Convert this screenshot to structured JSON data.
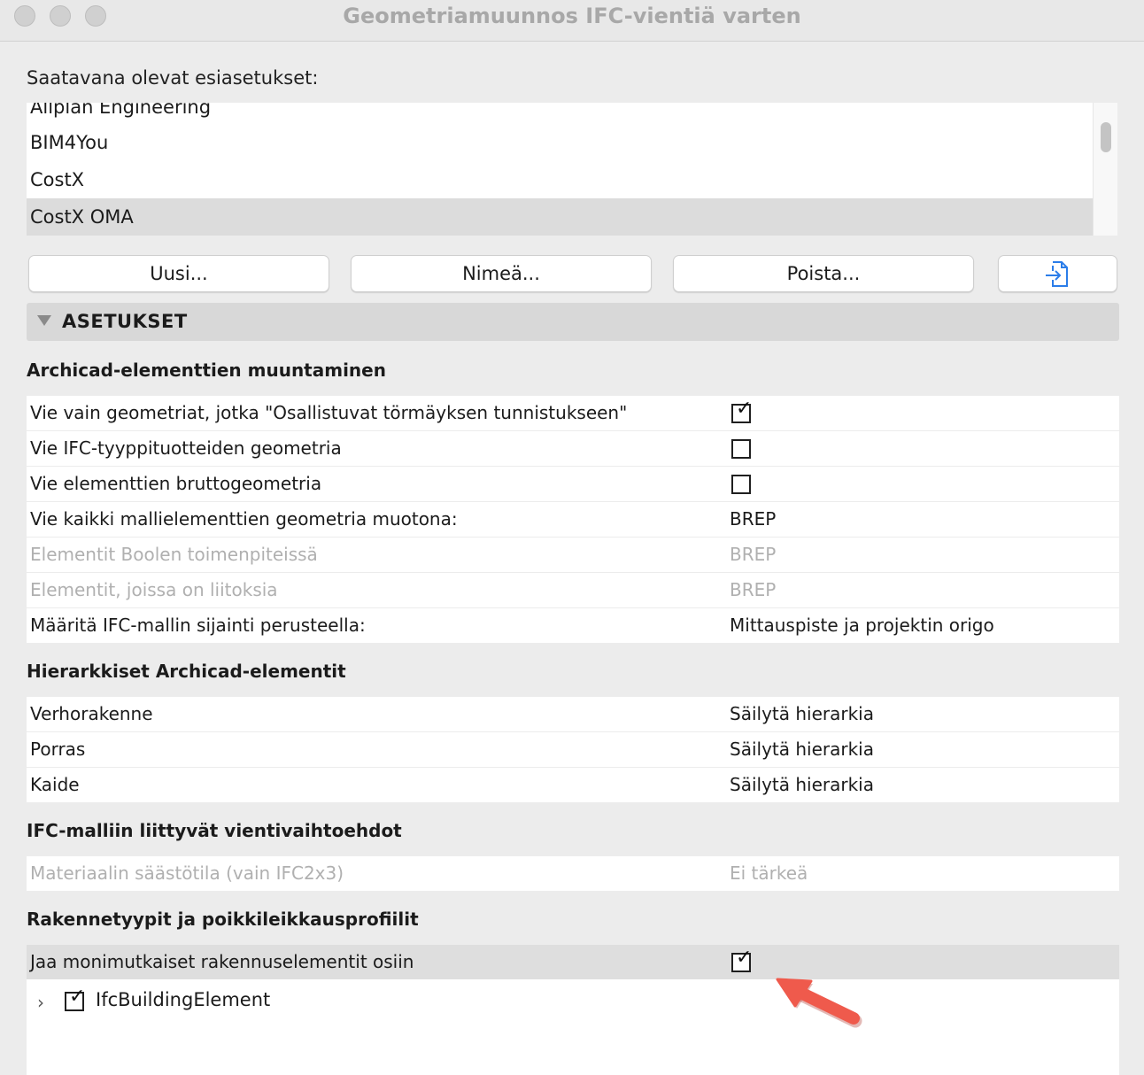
{
  "window": {
    "title": "Geometriamuunnos IFC-vientiä varten"
  },
  "presets": {
    "label": "Saatavana olevat esiasetukset:",
    "items": [
      "Allplan Engineering",
      "BIM4You",
      "CostX",
      "CostX OMA"
    ],
    "selected": "CostX OMA"
  },
  "buttons": {
    "new": "Uusi...",
    "rename": "Nimeä...",
    "delete": "Poista..."
  },
  "settings": {
    "header": "ASETUKSET",
    "group1": {
      "title": "Archicad-elementtien muuntaminen",
      "rows": [
        {
          "name": "Vie vain geometriat, jotka \"Osallistuvat törmäyksen tunnistukseen\"",
          "checked": true
        },
        {
          "name": "Vie IFC-tyyppituotteiden geometria",
          "checked": false
        },
        {
          "name": "Vie elementtien bruttogeometria",
          "checked": false
        },
        {
          "name": "Vie kaikki mallielementtien geometria muotona:",
          "value": "BREP"
        },
        {
          "name": "Elementit Boolen toimenpiteissä",
          "value": "BREP"
        },
        {
          "name": "Elementit, joissa on liitoksia",
          "value": "BREP"
        },
        {
          "name": "Määritä IFC-mallin sijainti perusteella:",
          "value": "Mittauspiste ja projektin origo"
        }
      ]
    },
    "group2": {
      "title": "Hierarkkiset Archicad-elementit",
      "rows": [
        {
          "name": "Verhorakenne",
          "value": "Säilytä hierarkia"
        },
        {
          "name": "Porras",
          "value": "Säilytä hierarkia"
        },
        {
          "name": "Kaide",
          "value": "Säilytä hierarkia"
        }
      ]
    },
    "group3": {
      "title": "IFC-malliin liittyvät vientivaihtoehdot",
      "rows": [
        {
          "name": "Materiaalin säästötila (vain IFC2x3)",
          "value": "Ei tärkeä"
        }
      ]
    },
    "group4": {
      "title": "Rakennetyypit ja poikkileikkausprofiilit",
      "rows": [
        {
          "name": "Jaa monimutkaiset rakennuselementit osiin",
          "checked": true
        }
      ],
      "tree": {
        "label": "IfcBuildingElement",
        "checked": true
      }
    }
  },
  "colors": {
    "accent": "#2b7de9",
    "annotation_arrow": "#ef5a4c",
    "selection": "#dcdcdc"
  },
  "icons": {
    "import": "import-icon",
    "check": "✓",
    "expand": "›"
  }
}
